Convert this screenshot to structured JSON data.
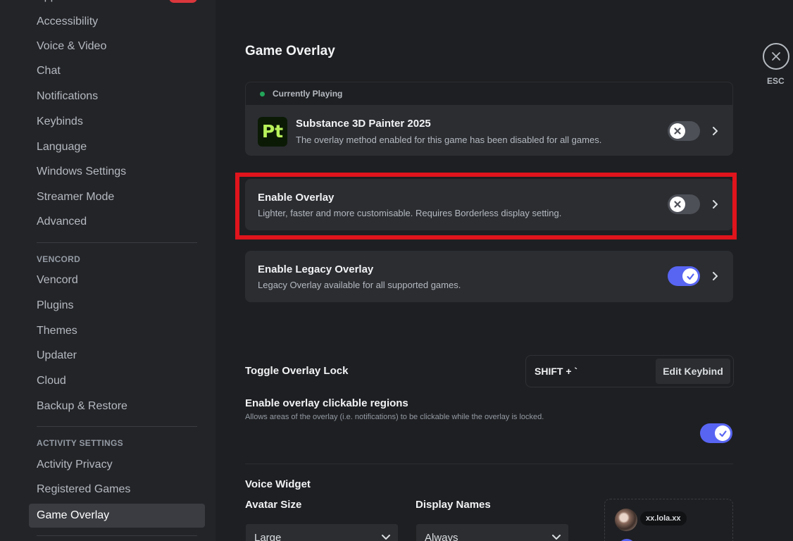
{
  "sidebar": {
    "items_top": [
      {
        "label": "Appearance"
      },
      {
        "label": "Accessibility"
      },
      {
        "label": "Voice & Video"
      },
      {
        "label": "Chat"
      },
      {
        "label": "Notifications"
      },
      {
        "label": "Keybinds"
      },
      {
        "label": "Language"
      },
      {
        "label": "Windows Settings"
      },
      {
        "label": "Streamer Mode"
      },
      {
        "label": "Advanced"
      }
    ],
    "vencord_header": "VENCORD",
    "items_vencord": [
      {
        "label": "Vencord"
      },
      {
        "label": "Plugins"
      },
      {
        "label": "Themes"
      },
      {
        "label": "Updater"
      },
      {
        "label": "Cloud"
      },
      {
        "label": "Backup & Restore"
      }
    ],
    "activity_header": "ACTIVITY SETTINGS",
    "items_activity": [
      {
        "label": "Activity Privacy"
      },
      {
        "label": "Registered Games"
      },
      {
        "label": "Game Overlay"
      }
    ]
  },
  "main": {
    "title": "Game Overlay",
    "currently_playing": {
      "header": "Currently Playing",
      "game_icon_text": "Pt",
      "game_title": "Substance 3D Painter 2025",
      "game_subtitle": "The overlay method enabled for this game has been disabled for all games.",
      "toggle_on": false
    },
    "enable_overlay": {
      "title": "Enable Overlay",
      "subtitle": "Lighter, faster and more customisable. Requires Borderless display setting.",
      "toggle_on": false
    },
    "legacy_overlay": {
      "title": "Enable Legacy Overlay",
      "subtitle": "Legacy Overlay available for all supported games.",
      "toggle_on": true
    },
    "toggle_lock": {
      "label": "Toggle Overlay Lock",
      "keybind_value": "SHIFT + `",
      "edit_button": "Edit Keybind"
    },
    "clickable_regions": {
      "title": "Enable overlay clickable regions",
      "description": "Allows areas of the overlay (i.e. notifications) to be clickable while the overlay is locked.",
      "toggle_on": true
    },
    "voice_widget": {
      "title": "Voice Widget",
      "avatar_size_label": "Avatar Size",
      "avatar_size_value": "Large",
      "display_names_label": "Display Names",
      "display_names_value": "Always",
      "preview_name": "xx.lola.xx"
    }
  },
  "close": {
    "label": "ESC"
  },
  "colors": {
    "accent": "#5865f2",
    "highlight": "#e0141c",
    "online": "#23a55a"
  }
}
